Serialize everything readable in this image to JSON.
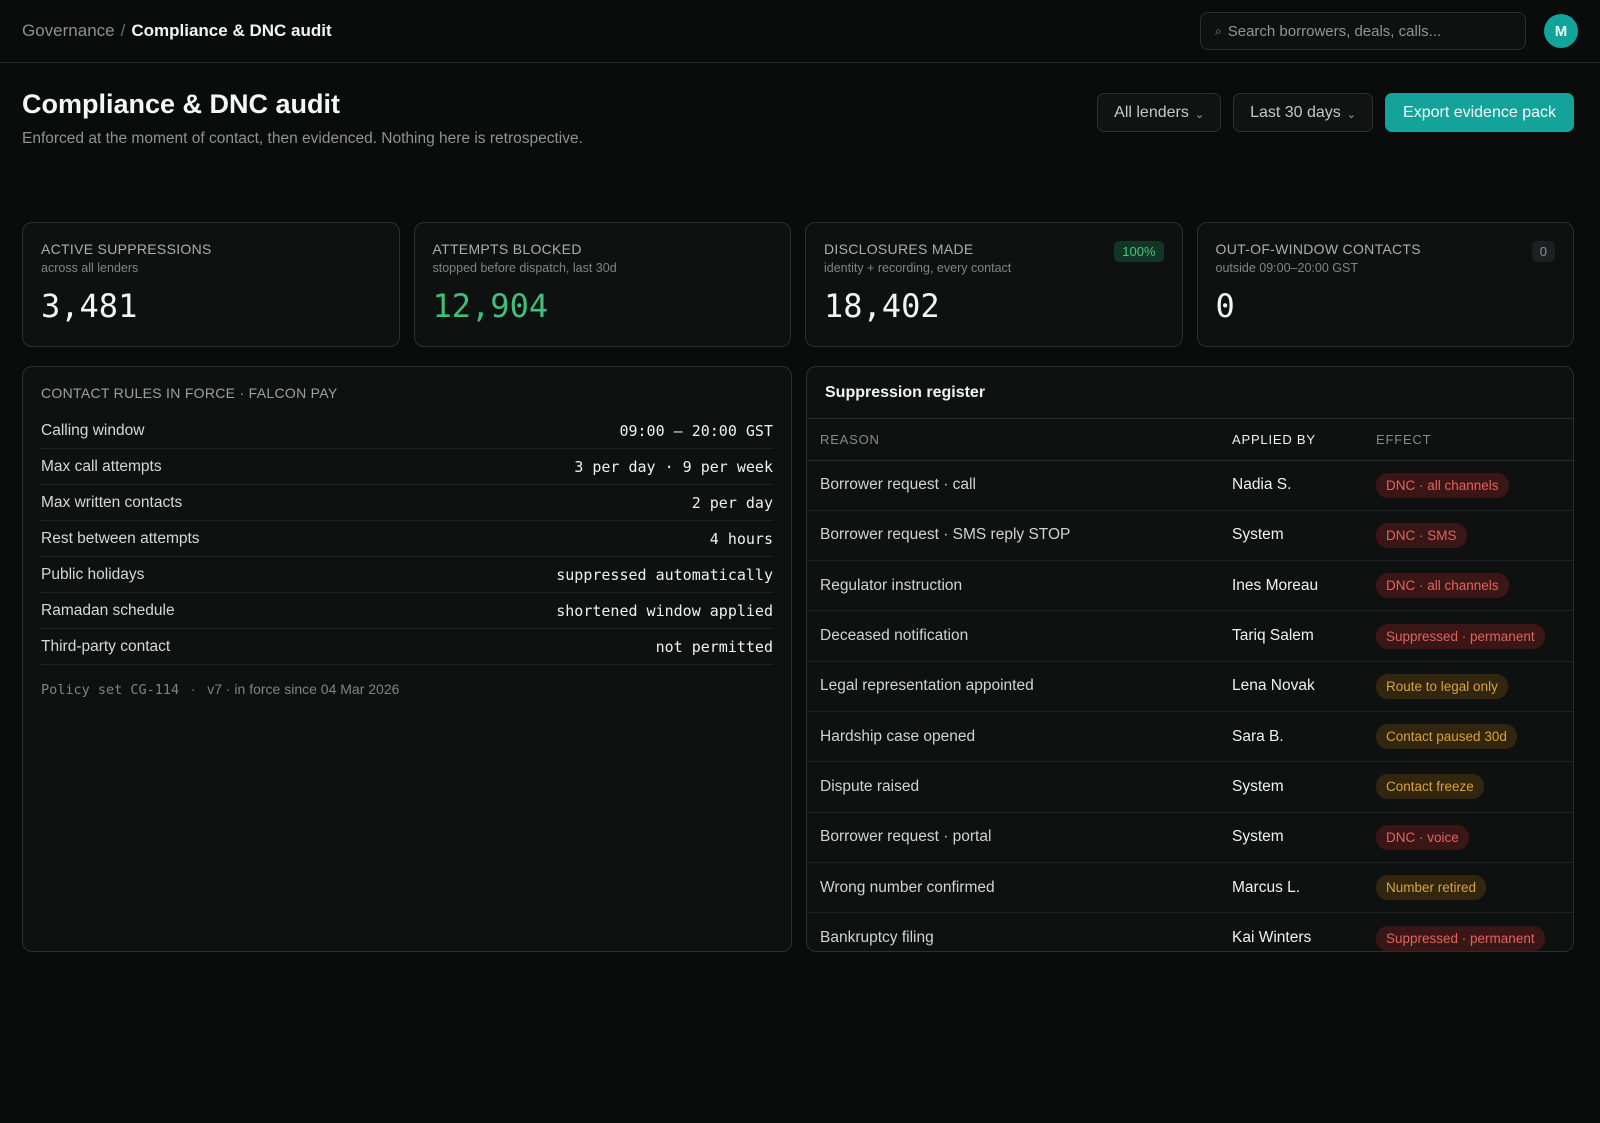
{
  "breadcrumb": {
    "parent": "Governance",
    "separator": "/",
    "current": "Compliance & DNC audit"
  },
  "search": {
    "placeholder": "Search borrowers, deals, calls..."
  },
  "user": {
    "initial": "M"
  },
  "page": {
    "title": "Compliance & DNC audit",
    "subtitle": "Enforced at the moment of contact, then evidenced. Nothing here is retrospective."
  },
  "controls": {
    "lender_filter": "All lenders",
    "date_filter": "Last 30 days",
    "export_label": "Export evidence pack"
  },
  "kpis": [
    {
      "label": "ACTIVE SUPPRESSIONS",
      "sub": "across all lenders",
      "value": "3,481",
      "badge": ""
    },
    {
      "label": "ATTEMPTS BLOCKED",
      "sub": "stopped before dispatch, last 30d",
      "value": "12,904",
      "badge": ""
    },
    {
      "label": "DISCLOSURES MADE",
      "sub": "identity + recording, every contact",
      "value": "18,402",
      "badge": "100%"
    },
    {
      "label": "OUT-OF-WINDOW CONTACTS",
      "sub": "outside 09:00–20:00 GST",
      "value": "0",
      "badge": "0"
    }
  ],
  "rules": {
    "heading": "CONTACT RULES IN FORCE · FALCON PAY",
    "items": [
      {
        "label": "Calling window",
        "value": "09:00 – 20:00 GST"
      },
      {
        "label": "Max call attempts",
        "value": "3 per day · 9 per week"
      },
      {
        "label": "Max written contacts",
        "value": "2 per day"
      },
      {
        "label": "Rest between attempts",
        "value": "4 hours"
      },
      {
        "label": "Public holidays",
        "value": "suppressed automatically"
      },
      {
        "label": "Ramadan schedule",
        "value": "shortened window applied"
      },
      {
        "label": "Third-party contact",
        "value": "not permitted"
      }
    ],
    "policy_code": "Policy set CG-114",
    "policy_sep": "·",
    "policy_version": "v7 · in force since 04 Mar 2026"
  },
  "register": {
    "title": "Suppression register",
    "columns": [
      "REASON",
      "APPLIED BY",
      "EFFECT"
    ],
    "rows": [
      {
        "reason": "Borrower request · call",
        "applied_by": "Nadia S.",
        "effect": "DNC · all channels"
      },
      {
        "reason": "Borrower request · SMS reply STOP",
        "applied_by": "System",
        "effect": "DNC · SMS"
      },
      {
        "reason": "Regulator instruction",
        "applied_by": "Ines Moreau",
        "effect": "DNC · all channels"
      },
      {
        "reason": "Deceased notification",
        "applied_by": "Tariq Salem",
        "effect": "Suppressed · permanent"
      },
      {
        "reason": "Legal representation appointed",
        "applied_by": "Lena Novak",
        "effect": "Route to legal only"
      },
      {
        "reason": "Hardship case opened",
        "applied_by": "Sara B.",
        "effect": "Contact paused 30d"
      },
      {
        "reason": "Dispute raised",
        "applied_by": "System",
        "effect": "Contact freeze"
      },
      {
        "reason": "Borrower request · portal",
        "applied_by": "System",
        "effect": "DNC · voice"
      },
      {
        "reason": "Wrong number confirmed",
        "applied_by": "Marcus L.",
        "effect": "Number retired"
      },
      {
        "reason": "Bankruptcy filing",
        "applied_by": "Kai Winters",
        "effect": "Suppressed · permanent"
      }
    ]
  },
  "colors": {
    "accent": "#14a39a",
    "positive": "#3fbf7a",
    "danger": "#e0645c",
    "warning": "#d9a13f"
  }
}
